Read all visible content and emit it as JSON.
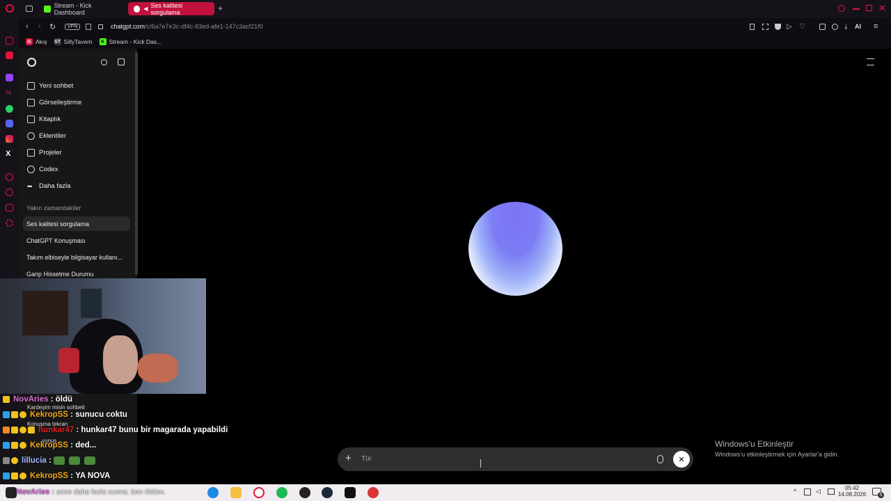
{
  "browser": {
    "tabs": [
      {
        "label": "Stream - Kick Dashboard",
        "active": false
      },
      {
        "label": "Ses kalitesi sorgulama",
        "active": true
      }
    ],
    "new_tab_label": "+",
    "vpn_label": "VPN",
    "url_host": "chatgpt.com",
    "url_path": "/c/6a7e7e3c-df4c-83ed-afe1-147c3acf21f0",
    "ai_label": "AI",
    "bookmarks": [
      "Akış",
      "SillyTavern",
      "Stream - Kick Das..."
    ],
    "accent_color": "#c1123d"
  },
  "sidebar": {
    "nav": [
      {
        "label": "Yeni sohbet",
        "icon": "edit-icon"
      },
      {
        "label": "Görselleştirme",
        "icon": "image-icon"
      },
      {
        "label": "Kitaplık",
        "icon": "library-icon"
      },
      {
        "label": "Eklentiler",
        "icon": "plugin-icon"
      },
      {
        "label": "Projeler",
        "icon": "folder-icon"
      },
      {
        "label": "Codex",
        "icon": "codex-icon"
      },
      {
        "label": "Daha fazla",
        "icon": "more-icon"
      }
    ],
    "recent_heading": "Yakın zamandakiler",
    "recent": [
      {
        "label": "Ses kalitesi sorgulama",
        "selected": true
      },
      {
        "label": "ChatGPT Konuşması",
        "selected": false
      },
      {
        "label": "Takım elbiseyle bilgisayar kullanı...",
        "selected": false
      },
      {
        "label": "Garip Hissetme Durumu",
        "selected": false
      }
    ],
    "hidden_items": [
      "Kardeşim misin sohbeti",
      "Konuşma tekrarı"
    ],
    "user_name": "yunus"
  },
  "composer": {
    "placeholder": "Tür"
  },
  "chat_overlay": [
    {
      "user": "NovAries",
      "color": "#d86fd6",
      "message": "öldü"
    },
    {
      "user": "KekropSS",
      "color": "#f2a81d",
      "message": "sunucu coktu"
    },
    {
      "user": "hunkar47",
      "color": "#e02222",
      "message": "hunkar47 bunu bir magarada yapabildi"
    },
    {
      "user": "KekropSS",
      "color": "#f2a81d",
      "message": "ded..."
    },
    {
      "user": "lillucia",
      "color": "#a9b6ff",
      "message": ""
    },
    {
      "user": "KekropSS",
      "color": "#f2a81d",
      "message": "YA NOVA"
    },
    {
      "user": "NovAries",
      "color": "#d86fd6",
      "message": "anne daha fazla vurma. ben öldüm."
    }
  ],
  "windows": {
    "activation_title": "Windows'u Etkinleştir",
    "activation_subtitle": "Windows'u etkinleştirmek için Ayarlar'a gidin.",
    "clock_time": "05:42",
    "clock_date": "14.08.2026",
    "notification_count": "5"
  }
}
